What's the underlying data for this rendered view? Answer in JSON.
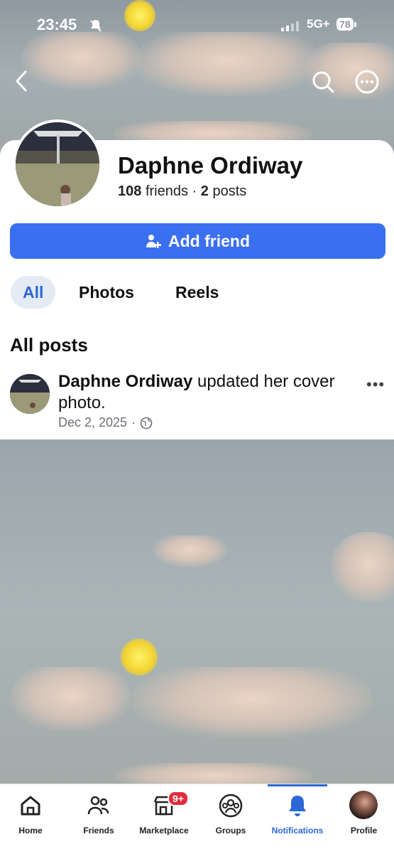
{
  "status": {
    "time": "23:45",
    "network": "5G+",
    "battery": "78"
  },
  "header": {
    "back_icon": "chevron-left-icon",
    "search_icon": "search-icon",
    "more_icon": "more-circle-icon"
  },
  "profile": {
    "name": "Daphne Ordiway",
    "friends_count": "108",
    "friends_label": "friends",
    "separator": "·",
    "posts_count": "2",
    "posts_label": "posts"
  },
  "actions": {
    "add_friend": "Add friend"
  },
  "tabs": [
    {
      "label": "All",
      "active": true
    },
    {
      "label": "Photos"
    },
    {
      "label": "Reels"
    }
  ],
  "section_title": "All posts",
  "post": {
    "author": "Daphne Ordiway",
    "action": "updated her cover photo.",
    "date": "Dec 2, 2025",
    "separator": "·",
    "privacy_icon": "globe-icon"
  },
  "bottom_nav": [
    {
      "label": "Home",
      "icon": "home-icon"
    },
    {
      "label": "Friends",
      "icon": "friends-icon"
    },
    {
      "label": "Marketplace",
      "icon": "marketplace-icon",
      "badge": "9+"
    },
    {
      "label": "Groups",
      "icon": "groups-icon"
    },
    {
      "label": "Notifications",
      "icon": "bell-icon",
      "active": true
    },
    {
      "label": "Profile",
      "icon": "profile-avatar"
    }
  ],
  "colors": {
    "accent": "#3a6ff0",
    "active_tab_bg": "#e4ebf5",
    "badge": "#e02d3c"
  }
}
